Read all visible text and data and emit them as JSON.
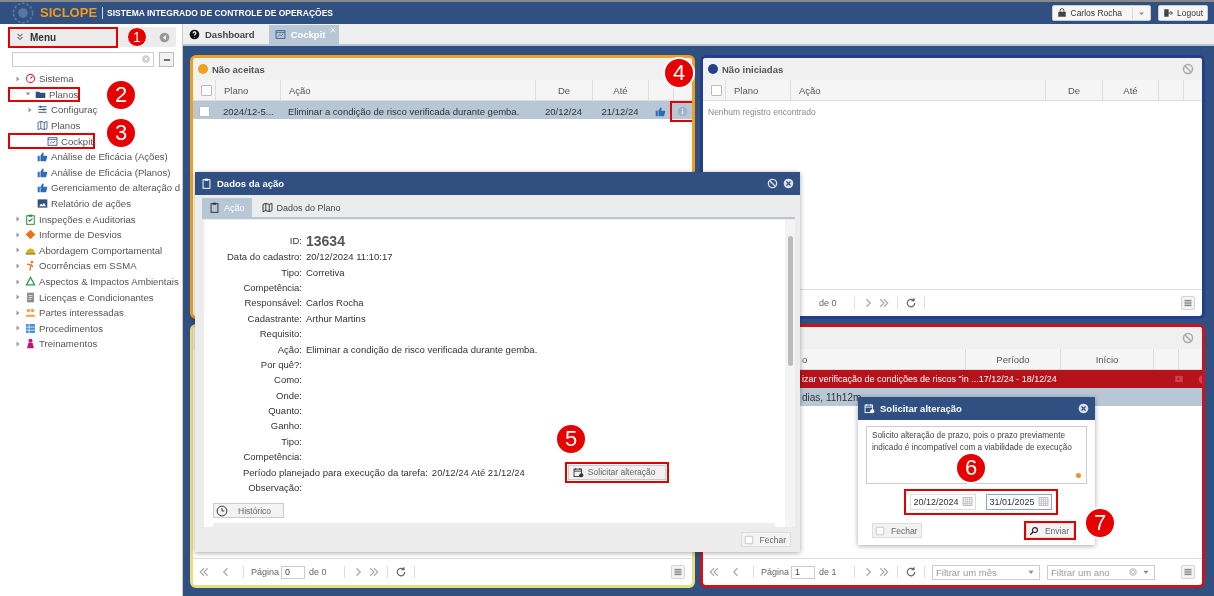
{
  "header": {
    "logo": "SICLOPE",
    "system_name": "SISTEMA INTEGRADO DE CONTROLE DE OPERAÇÕES",
    "user": "Carlos Rocha",
    "logout": "Logout"
  },
  "sidebar": {
    "title": "Menu",
    "items": [
      {
        "label": "Sistema",
        "expanded": false
      },
      {
        "label": "Planos",
        "expanded": true,
        "children": [
          {
            "label": "Configuraç",
            "kind": "group"
          },
          {
            "label": "Planos",
            "kind": "page"
          },
          {
            "label": "Cockpit",
            "kind": "page"
          },
          {
            "label": "Análise de Eficácia (Ações)",
            "kind": "page"
          },
          {
            "label": "Análise de Eficácia (Planos)",
            "kind": "page"
          },
          {
            "label": "Gerenciamento de alteração d",
            "kind": "page"
          },
          {
            "label": "Relatório de ações",
            "kind": "page"
          }
        ]
      },
      {
        "label": "Inspeções e Auditorias",
        "expanded": false
      },
      {
        "label": "Informe de Desvios",
        "expanded": false
      },
      {
        "label": "Abordagem Comportamental",
        "expanded": false
      },
      {
        "label": "Ocorrências em SSMA",
        "expanded": false
      },
      {
        "label": "Aspectos & Impactos Ambientais",
        "expanded": false
      },
      {
        "label": "Licenças e Condicionantes",
        "expanded": false
      },
      {
        "label": "Partes interessadas",
        "expanded": false
      },
      {
        "label": "Procedimentos",
        "expanded": false
      },
      {
        "label": "Treinamentos",
        "expanded": false
      }
    ]
  },
  "tabs": [
    {
      "label": "Dashboard",
      "selected": false,
      "closable": false
    },
    {
      "label": "Cockpit",
      "selected": true,
      "closable": true
    }
  ],
  "panels": [
    {
      "kind": "actions",
      "title": "Não aceitas",
      "color": "#f0a020",
      "all_checked": false,
      "columns": [
        "Plano",
        "Ação",
        "De",
        "Até"
      ],
      "rows": [
        {
          "kind": "normal",
          "cells": [
            "2024/12-5...",
            "Eliminar a condição de risco verificada durante gemba.",
            "20/12/24",
            "21/12/24"
          ],
          "selected": true,
          "checked": false
        }
      ]
    },
    {
      "kind": "actions",
      "title": "Não iniciadas",
      "color": "#233f8c",
      "all_checked": false,
      "columns": [
        "Plano",
        "Ação",
        "De",
        "Até"
      ],
      "empty_text": "Nenhum registro encontrado",
      "pager": {
        "of": "de 0"
      }
    },
    {
      "kind": "blank",
      "color": "#e6e07a",
      "pager": {
        "page_label": "Página",
        "page": "0",
        "of": "de 0"
      }
    },
    {
      "kind": "schedule",
      "color": "#c8141c",
      "columns": [
        "o",
        "Período",
        "Início"
      ],
      "rows": [
        {
          "kind": "late",
          "cells": [
            "izar verificação de condições de riscos \"in ...",
            "17/12/24 - 18/12/24"
          ],
          "selected": false
        },
        {
          "kind": "detail",
          "cells": [
            "dias, 11h12m"
          ],
          "selected": true
        }
      ],
      "pager": {
        "page_label": "Página",
        "page": "1",
        "of": "de 1",
        "filters": [
          "Filtrar um mês",
          "Filtrar um ano"
        ]
      }
    }
  ],
  "action_dialog": {
    "title": "Dados da ação",
    "tabs": [
      {
        "label": "Ação",
        "selected": true
      },
      {
        "label": "Dados do Plano",
        "selected": false
      }
    ],
    "fields": [
      {
        "kind": "id",
        "label": "ID:",
        "value": "13634"
      },
      {
        "kind": "text",
        "label": "Data do cadastro:",
        "value": "20/12/2024 11:10:17"
      },
      {
        "kind": "text",
        "label": "Tipo:",
        "value": "Corretiva"
      },
      {
        "kind": "text",
        "label": "Competência:"
      },
      {
        "kind": "text",
        "label": "Responsável:",
        "value": "Carlos Rocha"
      },
      {
        "kind": "text",
        "label": "Cadastrante:",
        "value": "Arthur Martins"
      },
      {
        "kind": "text",
        "label": "Requisito:"
      },
      {
        "kind": "text",
        "label": "Ação:",
        "value": "Eliminar a condição de risco verificada durante gemba."
      },
      {
        "kind": "text",
        "label": "Por quê?:"
      },
      {
        "kind": "text",
        "label": "Como:"
      },
      {
        "kind": "text",
        "label": "Onde:"
      },
      {
        "kind": "text",
        "label": "Quanto:"
      },
      {
        "kind": "text",
        "label": "Ganho:"
      },
      {
        "kind": "text",
        "label": "Tipo:"
      },
      {
        "kind": "text",
        "label": "Competência:"
      },
      {
        "kind": "period",
        "label": "Período planejado para execução da tarefa:",
        "value": "20/12/24 Até 21/12/24",
        "action": "Solicitar alteração"
      },
      {
        "kind": "text",
        "label": "Observação:"
      }
    ],
    "history_button": "Histórico",
    "close_button": "Fechar"
  },
  "change_dialog": {
    "title": "Solicitar alteração",
    "message": "Solicito alteração de prazo, pois o prazo previamente indicado é incompatível com a viabilidade de execução",
    "start_date": "20/12/2024",
    "end_date": "31/01/2025",
    "close_button": "Fechar",
    "send_button": "Enviar"
  },
  "annotations": [
    {
      "number": "1"
    },
    {
      "number": "2"
    },
    {
      "number": "3"
    },
    {
      "number": "4"
    },
    {
      "number": "5"
    },
    {
      "number": "6"
    },
    {
      "number": "7"
    }
  ]
}
